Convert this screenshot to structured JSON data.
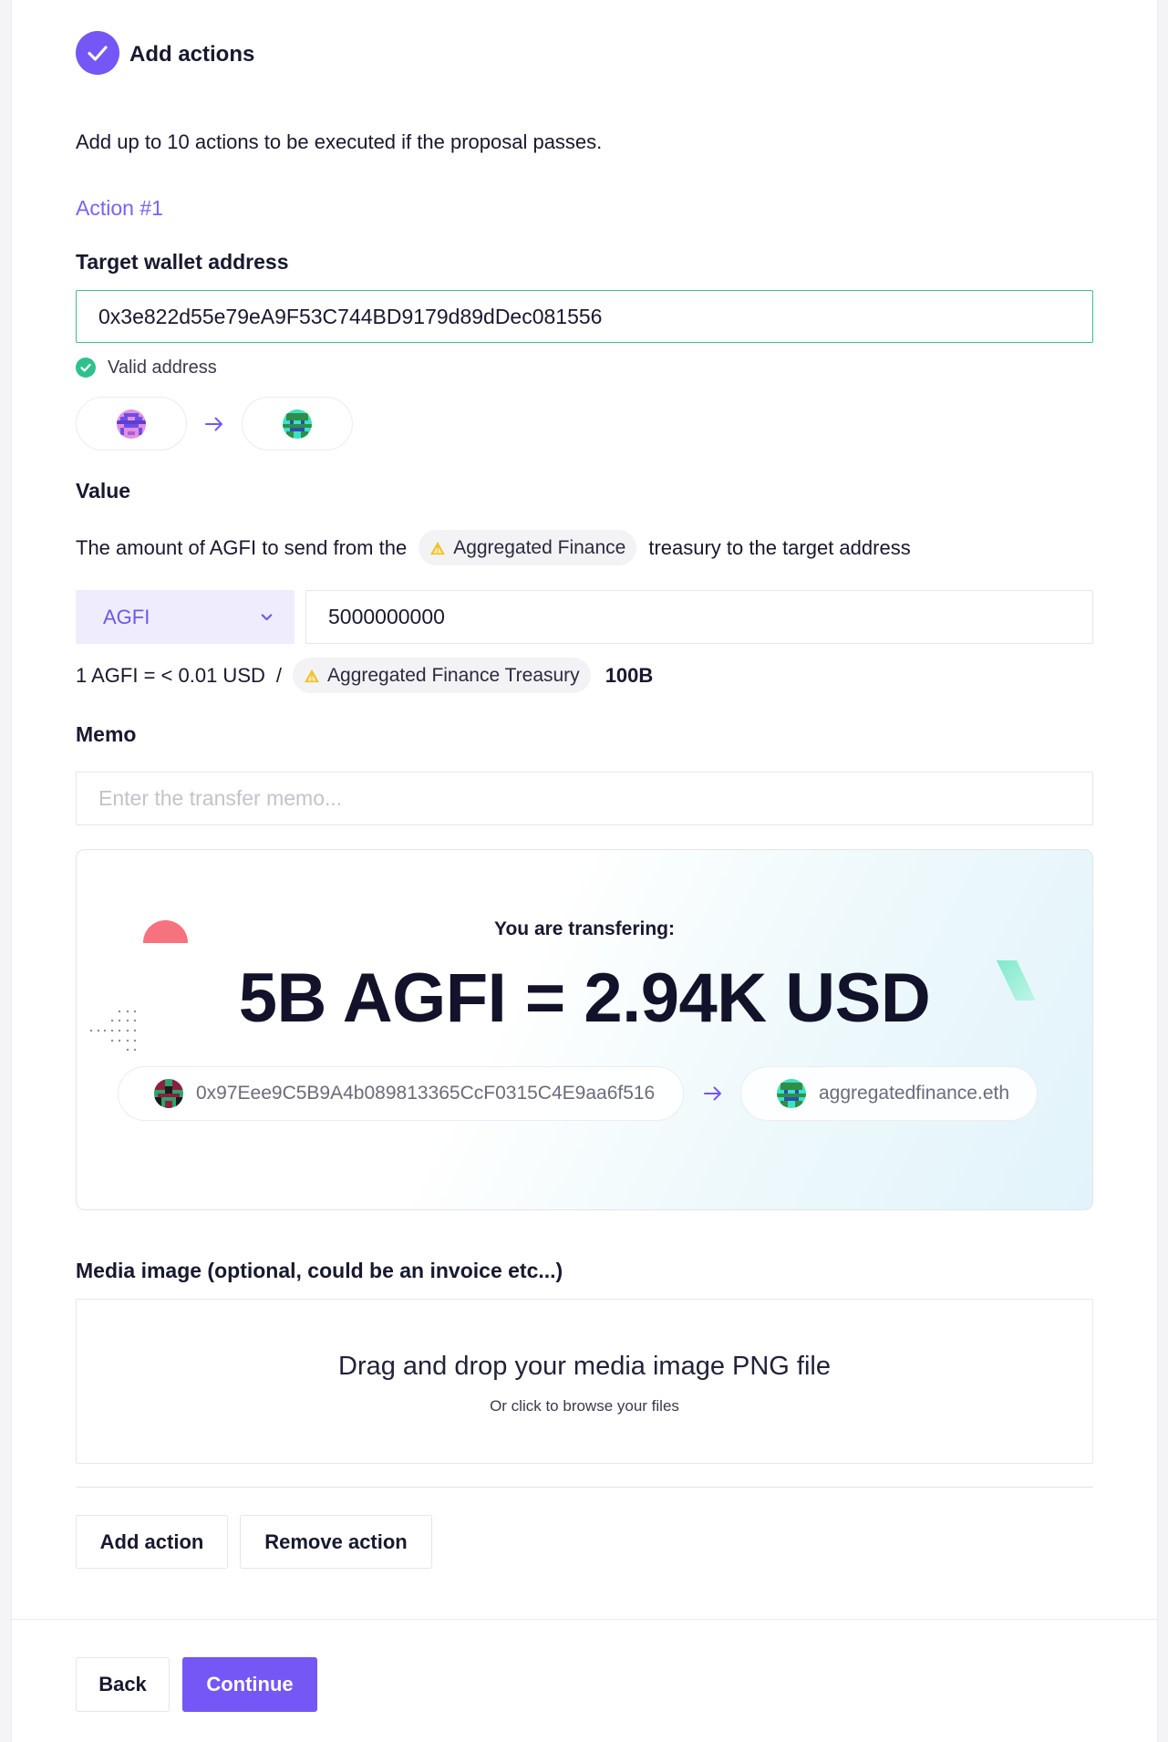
{
  "header": {
    "title": "Add actions"
  },
  "intro": "Add up to 10 actions to be executed if the proposal passes.",
  "action": {
    "heading": "Action #1",
    "target": {
      "label": "Target wallet address",
      "value": "0x3e822d55e79eA9F53C744BD9179d89dDec081556",
      "validation": "Valid address"
    },
    "value": {
      "label": "Value",
      "description_prefix": "The amount of AGFI to send from the",
      "dao_chip": "Aggregated Finance",
      "description_suffix": "treasury to the target address",
      "token": "AGFI",
      "amount": "5000000000",
      "rate": "1 AGFI = < 0.01 USD",
      "separator": "/",
      "treasury_chip": "Aggregated Finance Treasury",
      "treasury_balance": "100B"
    },
    "memo": {
      "label": "Memo",
      "placeholder": "Enter the transfer memo...",
      "value": ""
    },
    "preview": {
      "caption": "You are transfering:",
      "summary": "5B AGFI = 2.94K USD",
      "from": "0x97Eee9C5B9A4b089813365CcF0315C4E9aa6f516",
      "to": "aggregatedfinance.eth"
    },
    "media": {
      "label": "Media image (optional, could be an invoice etc...)",
      "drop_title": "Drag and drop your media image PNG file",
      "drop_hint": "Or click to browse your files"
    },
    "buttons": {
      "add": "Add action",
      "remove": "Remove action"
    }
  },
  "footer": {
    "back": "Back",
    "continue": "Continue"
  },
  "icons": {
    "step": "check-circle-icon",
    "valid": "valid-check-icon",
    "arrow": "arrow-right-icon",
    "dropdown": "chevron-down-icon",
    "token_logo": "aggregated-finance-logo-icon"
  },
  "colors": {
    "accent": "#7457f5",
    "accent_text": "#7b61ff",
    "success": "#2fc18c",
    "valid_border": "#3cc18f",
    "page_background": "#f4f4f7",
    "danger_shape": "#f7727f"
  }
}
